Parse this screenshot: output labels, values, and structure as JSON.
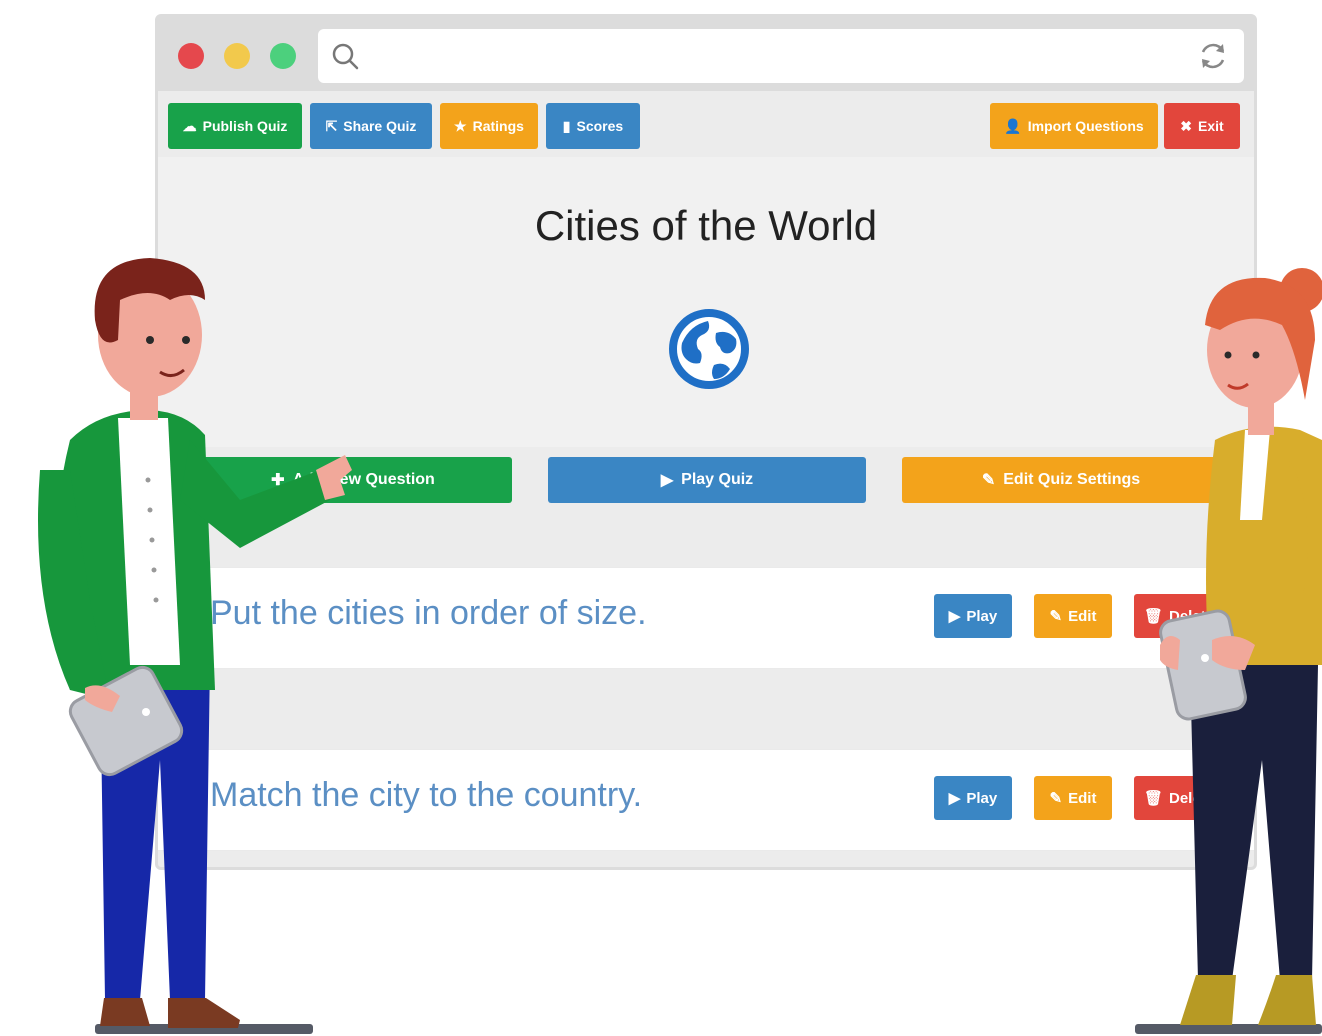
{
  "toolbar": {
    "publish": "Publish Quiz",
    "share": "Share Quiz",
    "ratings": "Ratings",
    "scores": "Scores",
    "import": "Import Questions",
    "exit": "Exit"
  },
  "quiz": {
    "title": "Cities of the World",
    "icon": "globe-icon"
  },
  "actions": {
    "add": "Add New Question",
    "play": "Play Quiz",
    "settings": "Edit Quiz Settings"
  },
  "questions": [
    {
      "text": "Put the cities in order of size.",
      "play": "Play",
      "edit": "Edit",
      "delete": "Delete"
    },
    {
      "text": "Match the city to the country.",
      "play": "Play",
      "edit": "Edit",
      "delete": "Delete"
    }
  ],
  "colors": {
    "green": "#18a24a",
    "blue": "#3a86c4",
    "orange": "#f3a31b",
    "red": "#e2463c"
  }
}
